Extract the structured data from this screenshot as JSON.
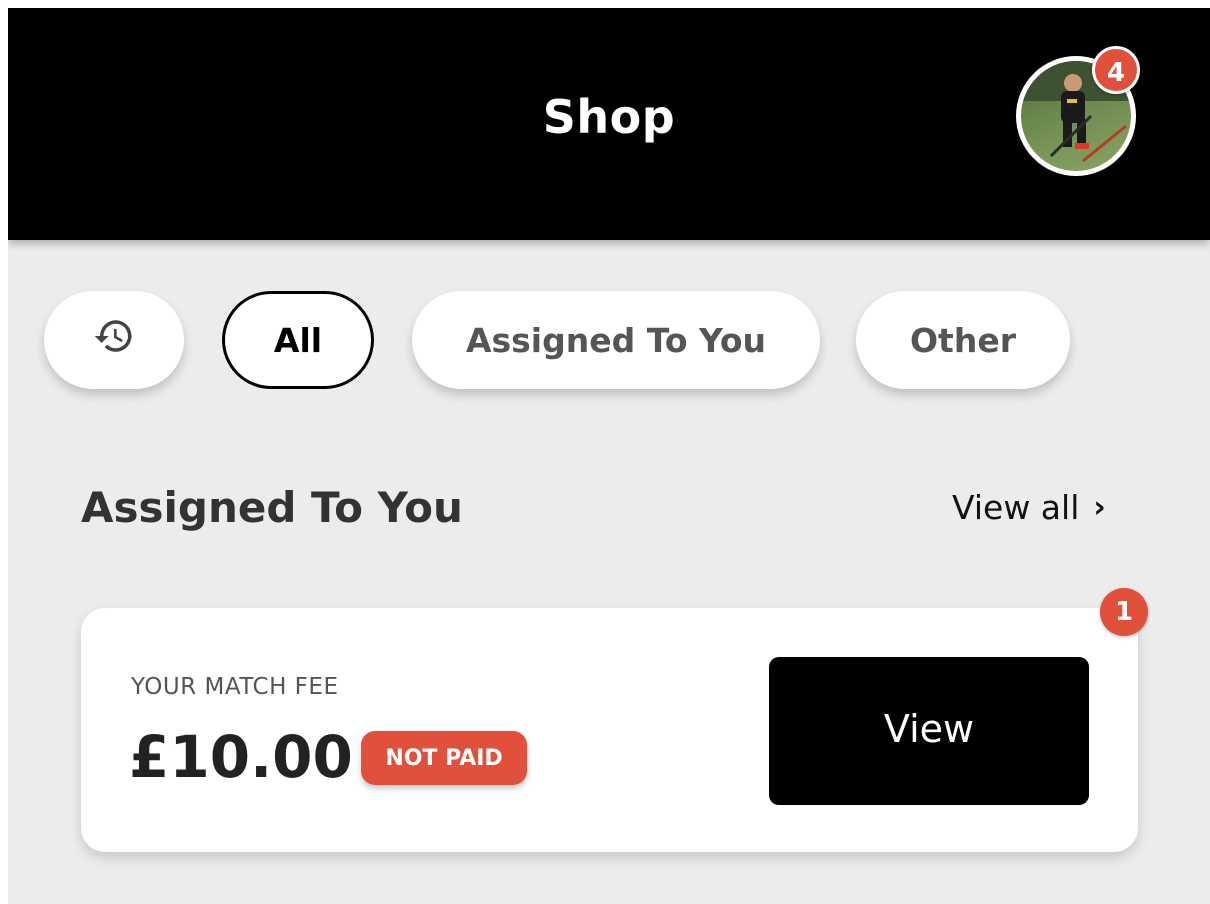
{
  "header": {
    "title": "Shop",
    "notification_count": "4",
    "avatar_alt": "player-avatar"
  },
  "filters": {
    "history_icon": "history-icon",
    "chips": [
      {
        "label": "All",
        "selected": true
      },
      {
        "label": "Assigned To You",
        "selected": false
      },
      {
        "label": "Other",
        "selected": false
      }
    ]
  },
  "section": {
    "title": "Assigned To You",
    "view_all_label": "View all",
    "view_all_icon": "chevron-right-icon"
  },
  "card": {
    "label": "YOUR MATCH FEE",
    "price": "£10.00",
    "status": "NOT PAID",
    "button_label": "View",
    "badge_count": "1"
  },
  "colors": {
    "header_bg": "#000000",
    "page_bg": "#ececec",
    "badge": "#e0503a",
    "status_not_paid": "#e0503a"
  }
}
